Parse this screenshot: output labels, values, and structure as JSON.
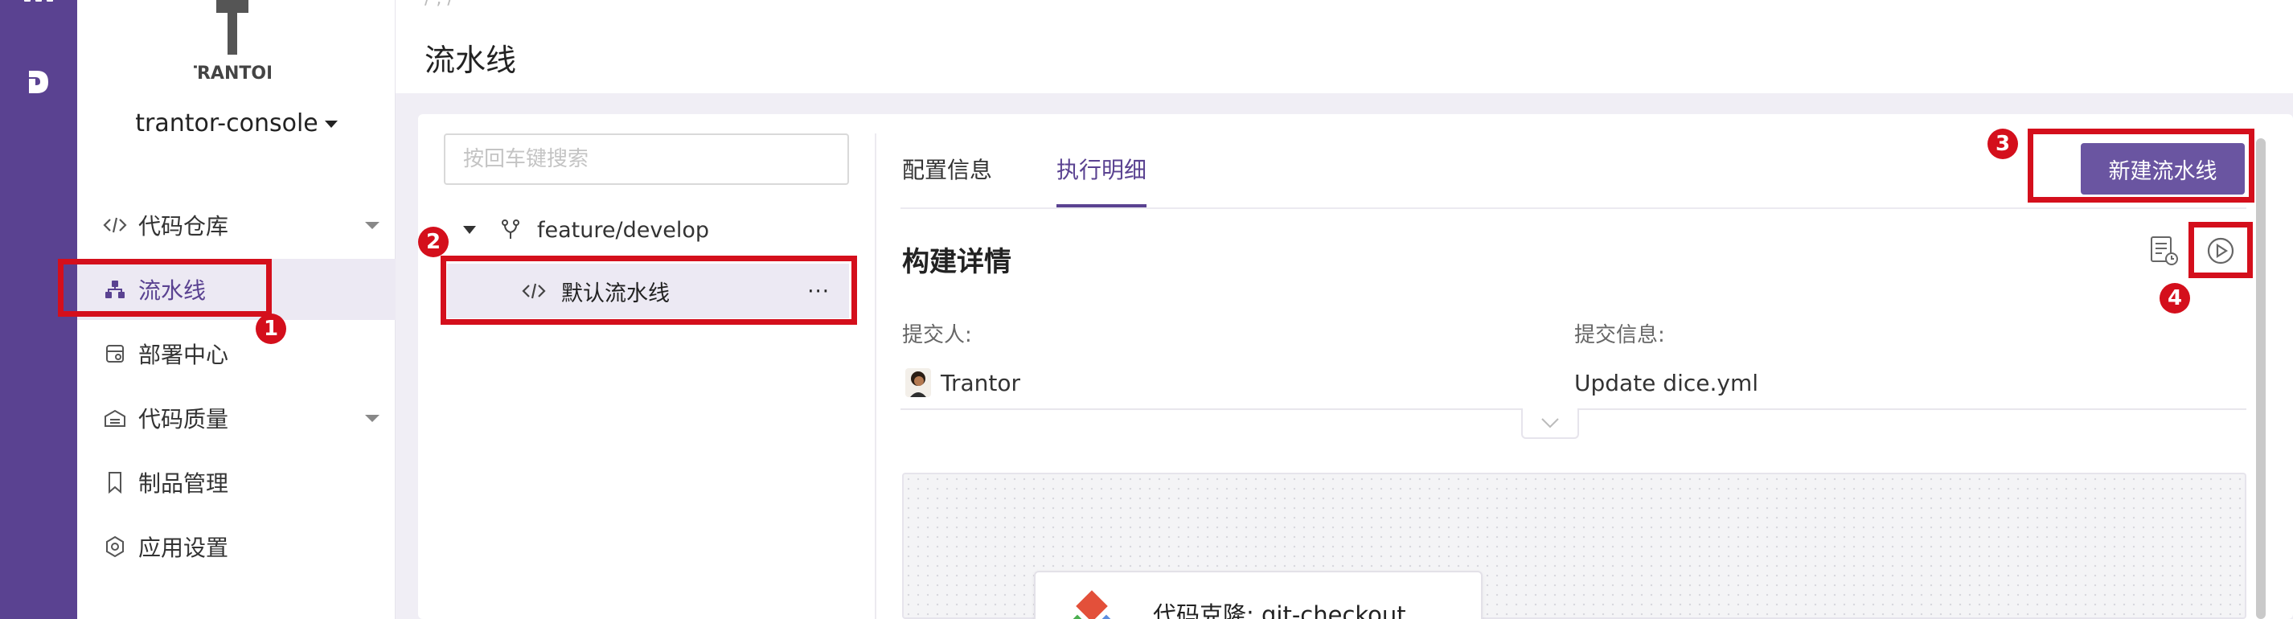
{
  "rail": {
    "grid_icon": "apps-grid-icon",
    "brand_icon": "brand-logo-icon"
  },
  "sidebar": {
    "logo_text": "TRANTOR",
    "project_name": "trantor-console",
    "items": [
      {
        "label": "代码仓库",
        "icon": "code-icon",
        "has_arrow": true
      },
      {
        "label": "流水线",
        "icon": "pipeline-icon",
        "active": true
      },
      {
        "label": "部署中心",
        "icon": "deploy-icon"
      },
      {
        "label": "代码质量",
        "icon": "quality-icon",
        "has_arrow": true
      },
      {
        "label": "制品管理",
        "icon": "bookmark-icon"
      },
      {
        "label": "应用设置",
        "icon": "settings-icon"
      }
    ]
  },
  "header": {
    "title": "流水线",
    "crumb_fragment": "/ ,  /"
  },
  "search": {
    "placeholder": "按回车键搜索"
  },
  "tree": {
    "branch": "feature/develop",
    "pipeline": "默认流水线",
    "more": "···"
  },
  "tabs": [
    {
      "label": "配置信息"
    },
    {
      "label": "执行明细",
      "active": true
    }
  ],
  "actions": {
    "new_pipeline": "新建流水线"
  },
  "build": {
    "title": "构建详情",
    "submitter_label": "提交人:",
    "submitter": "Trantor",
    "message_label": "提交信息:",
    "message": "Update dice.yml"
  },
  "node": {
    "label": "代码克隆: git-checkout"
  },
  "annotations": [
    "1",
    "2",
    "3",
    "4"
  ],
  "colors": {
    "accent": "#5a4291",
    "highlight": "#d40f1c",
    "button": "#6a55a1"
  }
}
